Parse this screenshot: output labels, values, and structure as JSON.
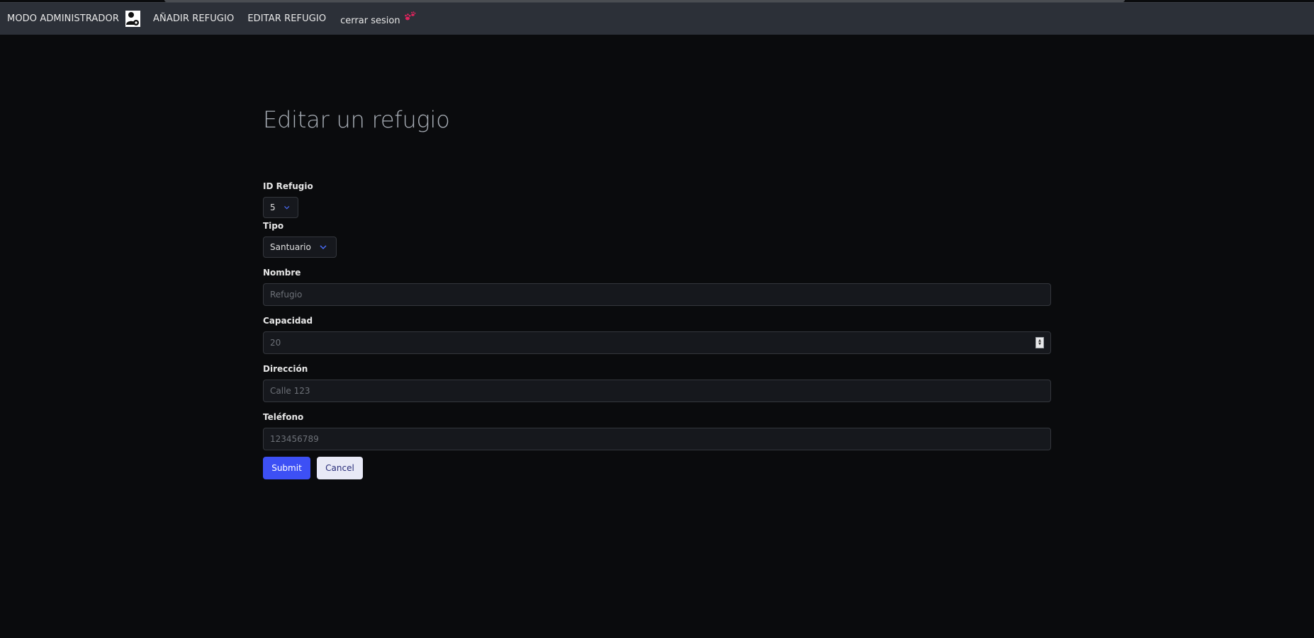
{
  "navbar": {
    "brand_label": "MODO ADMINISTRADOR",
    "links": [
      {
        "label": "AÑADIR REFUGIO"
      },
      {
        "label": "EDITAR REFUGIO"
      }
    ],
    "logout_label": "cerrar sesion"
  },
  "page": {
    "title": "Editar un refugio"
  },
  "form": {
    "id_label": "ID Refugio",
    "id_value": "5",
    "tipo_label": "Tipo",
    "tipo_value": "Santuario",
    "nombre_label": "Nombre",
    "nombre_placeholder": "Refugio",
    "capacidad_label": "Capacidad",
    "capacidad_placeholder": "20",
    "direccion_label": "Dirección",
    "direccion_placeholder": "Calle 123",
    "telefono_label": "Teléfono",
    "telefono_placeholder": "123456789",
    "submit_label": "Submit",
    "cancel_label": "Cancel"
  },
  "colors": {
    "background": "#0a0b0d",
    "navbar": "#2c3038",
    "primary": "#3d50f5",
    "chevron": "#4a6cf7"
  }
}
